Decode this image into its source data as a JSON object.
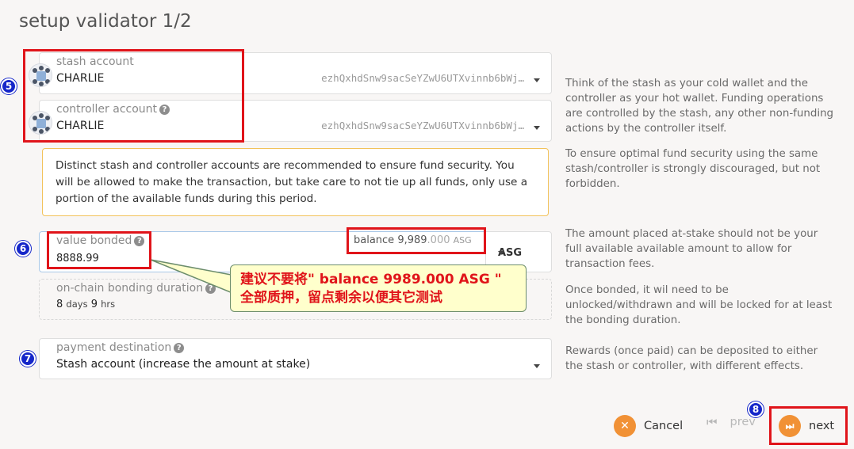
{
  "page": {
    "title": "setup validator 1/2"
  },
  "stash": {
    "label": "stash account",
    "value": "CHARLIE",
    "address": "ezhQxhdSnw9sacSeYZwU6UTXvinnb6bWj…"
  },
  "controller": {
    "label": "controller account",
    "value": "CHARLIE",
    "address": "ezhQxhdSnw9sacSeYZwU6UTXvinnb6bWj…"
  },
  "notice": {
    "text": "Distinct stash and controller accounts are recommended to ensure fund security. You will be allowed to make the transaction, but take care to not tie up all funds, only use a portion of the available funds during this period."
  },
  "bond": {
    "label": "value bonded",
    "value": "8888.99",
    "unit": "ASG",
    "balance_label": "balance",
    "balance_int": "9,989",
    "balance_dec": ".000",
    "balance_unit": "ASG"
  },
  "duration": {
    "label": "on-chain bonding duration",
    "days_n": "8",
    "days_u": "days",
    "hrs_n": "9",
    "hrs_u": "hrs"
  },
  "payment": {
    "label": "payment destination",
    "value": "Stash account (increase the amount at stake)"
  },
  "help": {
    "accounts": "Think of the stash as your cold wallet and the controller as your hot wallet. Funding operations are controlled by the stash, any other non-funding actions by the controller itself.",
    "security": "To ensure optimal fund security using the same stash/controller is strongly discouraged, but not forbidden.",
    "amount": "The amount placed at-stake should not be your full available available amount to allow for transaction fees.",
    "bonded": "Once bonded, it wil need to be unlocked/withdrawn and will be locked for at least the bonding duration.",
    "rewards": "Rewards (once paid) can be deposited to either the stash or controller, with different effects."
  },
  "annotation": {
    "line1": "建议不要将\" balance 9989.000 ASG \"",
    "line2": "全部质押，留点剩余以便其它测试",
    "markers": [
      "5",
      "6",
      "7",
      "8"
    ]
  },
  "buttons": {
    "cancel": "Cancel",
    "prev": "prev",
    "next": "next"
  },
  "colors": {
    "accent": "#f19135",
    "annotation_red": "#e0141a",
    "marker_blue": "#1526c9"
  }
}
